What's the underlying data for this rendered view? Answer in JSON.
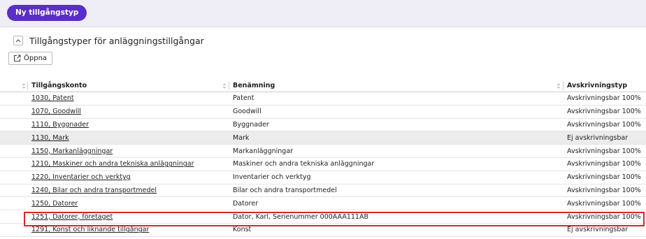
{
  "toolbar": {
    "new_button_label": "Ny tillgångstyp"
  },
  "section": {
    "title": "Tillgångstyper för anläggningstillgångar",
    "open_button_label": "Öppna"
  },
  "table": {
    "columns": [
      "Tillgångskonto",
      "Benämning",
      "Avskrivningstyp"
    ],
    "rows": [
      {
        "account": "1030, Patent",
        "name": "Patent",
        "type": "Avskrivningsbar 100%"
      },
      {
        "account": "1070, Goodwill",
        "name": "Goodwill",
        "type": "Avskrivningsbar 100%"
      },
      {
        "account": "1110, Byggnader",
        "name": "Byggnader",
        "type": "Avskrivningsbar 100%"
      },
      {
        "account": "1130, Mark",
        "name": "Mark",
        "type": "Ej avskrivningsbar"
      },
      {
        "account": "1150, Markanläggningar",
        "name": "Markanläggningar",
        "type": "Avskrivningsbar 100%"
      },
      {
        "account": "1210, Maskiner och andra tekniska anläggningar",
        "name": "Maskiner och andra tekniska anläggningar",
        "type": "Avskrivningsbar 100%"
      },
      {
        "account": "1220, Inventarier och verktyg",
        "name": "Inventarier och verktyg",
        "type": "Avskrivningsbar 100%"
      },
      {
        "account": "1240, Bilar och andra transportmedel",
        "name": "Bilar och andra transportmedel",
        "type": "Avskrivningsbar 100%"
      },
      {
        "account": "1250, Datorer",
        "name": "Datorer",
        "type": "Avskrivningsbar 100%"
      },
      {
        "account": "1251, Datorer, företaget",
        "name": "Dator, Karl, Serienummer 000AAA111AB",
        "type": "Avskrivningsbar 100%"
      },
      {
        "account": "1291, Konst och liknande tillgångar",
        "name": "Konst",
        "type": "Ej avskrivningsbar"
      }
    ]
  },
  "icons": {
    "collapse": "chevron-up-icon",
    "open": "external-link-icon",
    "sort": "sort-icon"
  },
  "colors": {
    "primary": "#5a2ec8",
    "highlight": "#d9262c",
    "selected_row": "#ececec"
  }
}
